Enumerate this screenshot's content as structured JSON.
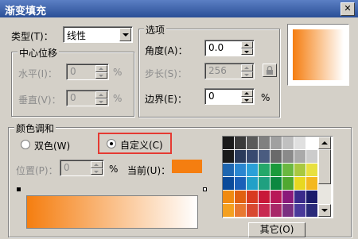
{
  "window": {
    "title": "渐变填充",
    "close_icon": "close-icon"
  },
  "type_field": {
    "label": "类型(T)：",
    "value": "线性"
  },
  "center_offset": {
    "group_label": "中心位移",
    "horizontal": {
      "label": "水平(I)：",
      "value": "0",
      "unit": "%"
    },
    "vertical": {
      "label": "垂直(V)：",
      "value": "0",
      "unit": "%"
    }
  },
  "options": {
    "group_label": "选项",
    "angle": {
      "label": "角度(A)：",
      "value": "0.0"
    },
    "steps": {
      "label": "步长(S)：",
      "value": "256"
    },
    "edge": {
      "label": "边界(E)：",
      "value": "0",
      "unit": "%"
    }
  },
  "color_blend": {
    "group_label": "颜色调和",
    "two_color_label": "双色(W)",
    "custom_label": "自定义(C)",
    "position_label": "位置(P)：",
    "position_value": "0",
    "position_unit": "%",
    "current_label": "当前(U)：",
    "current_color": "#f57e10",
    "other_button": "其它(O)"
  },
  "colors": {
    "gradient_start": "#f57e10",
    "gradient_end": "#ffffff",
    "highlight": "#e53a32"
  },
  "palette": [
    "#1a1a1a",
    "#3a3a3a",
    "#5a5a5a",
    "#808080",
    "#a0a0a0",
    "#c0c0c0",
    "#e0e0e0",
    "#ffffff",
    "#1a1a1a",
    "#2a3a5a",
    "#384a70",
    "#4a5c80",
    "#6a6a6a",
    "#8a8a8a",
    "#aaaaaa",
    "#cccccc",
    "#1e66b0",
    "#2a86d0",
    "#2aa0d8",
    "#24a86a",
    "#1a9a3a",
    "#6ab840",
    "#a8c840",
    "#e8e040",
    "#0a4a9a",
    "#1a60b8",
    "#22a0c8",
    "#20a080",
    "#0c8840",
    "#50a830",
    "#e8d820",
    "#f4b820",
    "#f08a10",
    "#e06010",
    "#d83a20",
    "#c81838",
    "#b81858",
    "#8a1a7a",
    "#3a2a8a",
    "#1a1a6a",
    "#f4a020",
    "#e87830",
    "#d84830",
    "#c82a50",
    "#a82868",
    "#7a3080",
    "#4a3a9a",
    "#2a2a7a"
  ]
}
